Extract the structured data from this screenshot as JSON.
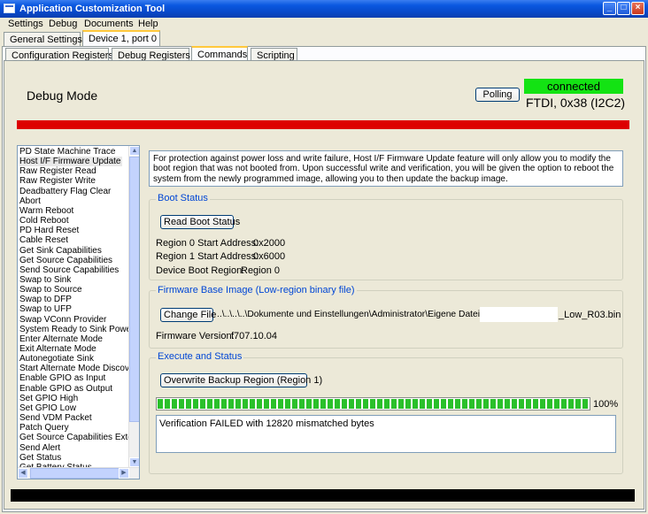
{
  "window": {
    "title": "Application Customization Tool"
  },
  "menu": [
    "Settings",
    "Debug",
    "Documents",
    "Help"
  ],
  "outer_tabs": [
    {
      "label": "General Settings",
      "active": false
    },
    {
      "label": "Device 1, port 0",
      "active": true
    }
  ],
  "inner_tabs": [
    {
      "label": "Configuration Registers",
      "active": false
    },
    {
      "label": "Debug Registers",
      "active": false
    },
    {
      "label": "Commands",
      "active": true
    },
    {
      "label": "Scripting",
      "active": false
    }
  ],
  "header": {
    "mode_title": "Debug Mode",
    "polling_label": "Polling",
    "status": "connected",
    "status_color": "#13e313",
    "interface": "FTDI, 0x38 (I2C2)"
  },
  "commands": {
    "selected": "Host I/F Firmware Update",
    "items": [
      "PD State Machine Trace",
      "Host I/F Firmware Update",
      "Raw Register Read",
      "Raw Register Write",
      "Deadbattery Flag Clear",
      "Abort",
      "Warm Reboot",
      "Cold Reboot",
      "PD Hard Reset",
      "Cable Reset",
      "Get Sink Capabilities",
      "Get Source Capabilities",
      "Send Source Capabilities",
      "Swap to Sink",
      "Swap to Source",
      "Swap to DFP",
      "Swap to UFP",
      "Swap VConn Provider",
      "System Ready to Sink Powe",
      "Enter Alternate Mode",
      "Exit Alternate Mode",
      "Autonegotiate Sink",
      "Start Alternate Mode Discov",
      "Enable GPIO as Input",
      "Enable GPIO as Output",
      "Set GPIO High",
      "Set GPIO Low",
      "Send VDM Packet",
      "Patch Query",
      "Get Source Capabilities Exte",
      "Send Alert",
      "Get Status",
      "Get Battery Status"
    ]
  },
  "description": "For protection against power loss and write failure, Host I/F Firmware Update feature will only allow you to modify the boot region that was not booted from. Upon successful write and verification, you will be given the option to reboot the system from the newly programmed image, allowing you to then update the backup image.",
  "boot_status": {
    "group_label": "Boot Status",
    "read_button": "Read Boot Status",
    "region0_label": "Region 0 Start Address:",
    "region0_value": "0x2000",
    "region1_label": "Region 1 Start Address:",
    "region1_value": "0x6000",
    "device_region_label": "Device Boot Region:",
    "device_region_value": "Region 0"
  },
  "firmware": {
    "group_label": "Firmware Base Image (Low-region binary file)",
    "change_button": "Change File",
    "path_prefix": "..\\..\\..\\..\\Dokumente und Einstellungen\\Administrator\\Eigene Dateien\\",
    "path_suffix": "_Low_R03.bin",
    "version_label": "Firmware Version:",
    "version_value": "f707.10.04"
  },
  "execute": {
    "group_label": "Execute and Status",
    "overwrite_button": "Overwrite Backup Region (Region 1)",
    "progress_percent": 100,
    "progress_label": "100%",
    "result_text": "Verification FAILED with 12820 mismatched bytes"
  }
}
